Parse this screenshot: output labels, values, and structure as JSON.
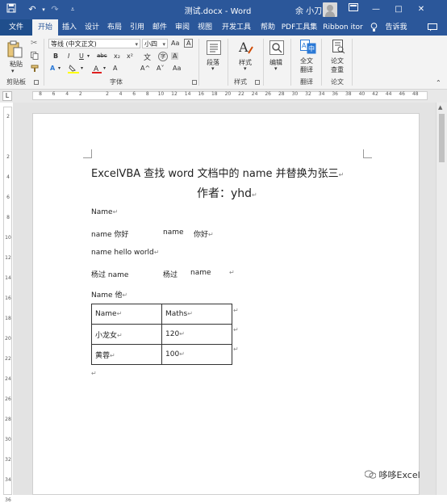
{
  "window": {
    "title": "测试.docx - Word",
    "user": "余 小刀"
  },
  "quick_access": {
    "save": "save-icon",
    "undo": "undo-icon",
    "redo": "redo-icon",
    "customize": "customize-icon"
  },
  "window_controls": {
    "restore": "restore-icon",
    "minimize": "—",
    "maximize": "□",
    "close": "✕"
  },
  "tabs": [
    "文件",
    "开始",
    "插入",
    "设计",
    "布局",
    "引用",
    "邮件",
    "审阅",
    "视图",
    "开发工具",
    "帮助",
    "PDF工具集",
    "Ribbon itor"
  ],
  "tell_me": "告诉我",
  "ribbon": {
    "clipboard": {
      "paste": "粘贴",
      "group": "剪贴板"
    },
    "font": {
      "name": "等线 (中文正文)",
      "size": "小四",
      "group": "字体",
      "bold": "B",
      "italic": "I",
      "underline": "U",
      "strike": "abc",
      "subscript": "x₂",
      "superscript": "x²",
      "grow": "A^",
      "shrink": "A˅",
      "case": "Aa",
      "clear": "A",
      "color": "A",
      "highlight": "ab",
      "char_border": "A",
      "phonetic": "wén",
      "enclose": "字",
      "shading": "A"
    },
    "paragraph": {
      "label": "段落"
    },
    "styles": {
      "label": "样式",
      "group": "样式"
    },
    "editing": {
      "label": "编辑"
    },
    "translate": {
      "label1": "全文",
      "label2": "翻译",
      "group": "翻译"
    },
    "paper": {
      "label1": "论文",
      "label2": "查重",
      "group": "论文"
    }
  },
  "ruler": {
    "h_marks": [
      "8",
      "6",
      "4",
      "2",
      "",
      "2",
      "4",
      "6",
      "8",
      "10",
      "12",
      "14",
      "16",
      "18",
      "20",
      "22",
      "24",
      "26",
      "28",
      "30",
      "32",
      "34",
      "36",
      "38",
      "40",
      "42",
      "44",
      "46",
      "48"
    ],
    "v_marks": [
      "2",
      "",
      "2",
      "4",
      "6",
      "8",
      "10",
      "12",
      "14",
      "16",
      "18",
      "20",
      "22",
      "24",
      "26",
      "28",
      "30",
      "32",
      "34",
      "36"
    ],
    "corner": "L"
  },
  "document": {
    "title": "ExcelVBA 查找 word 文档中的 name 并替换为张三",
    "author": "作者：yhd",
    "lines": [
      {
        "a": "Name",
        "b": "",
        "c": ""
      },
      {
        "a": "name 你好",
        "b": "name",
        "c": "你好"
      },
      {
        "a": "name hello world",
        "b": "",
        "c": ""
      },
      {
        "a": "杨过 name",
        "b": "杨过",
        "c": "name"
      },
      {
        "a": "Name 他",
        "b": "",
        "c": ""
      }
    ],
    "table": [
      [
        "Name",
        "Maths"
      ],
      [
        "小龙女",
        "120"
      ],
      [
        "黄蓉",
        "100"
      ]
    ]
  },
  "watermark": "哆哆Excel"
}
